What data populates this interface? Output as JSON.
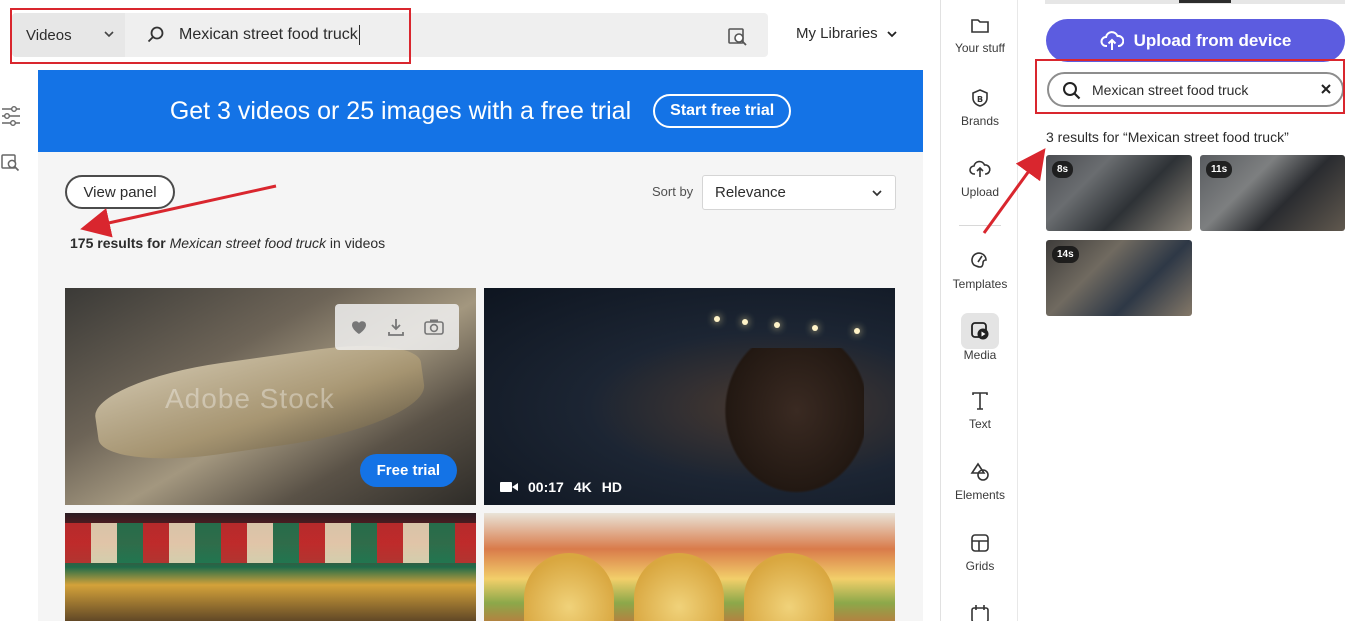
{
  "stock": {
    "search": {
      "type_label": "Videos",
      "query": "Mexican street food truck"
    },
    "my_libraries_label": "My Libraries",
    "promo": {
      "text": "Get 3 videos or 25 images with a free trial",
      "button": "Start free trial"
    },
    "view_panel_label": "View panel",
    "sort": {
      "label": "Sort by",
      "value": "Relevance"
    },
    "results": {
      "count": "175 results for",
      "query": "Mexican street food truck",
      "suffix": "in videos"
    },
    "tiles": [
      {
        "watermark": "Adobe Stock",
        "cta": "Free trial"
      },
      {
        "duration": "00:17",
        "quality1": "4K",
        "quality2": "HD"
      }
    ]
  },
  "sidenav": {
    "items": [
      {
        "label": "Your stuff",
        "icon": "folder-icon"
      },
      {
        "label": "Brands",
        "icon": "brand-icon"
      },
      {
        "label": "Upload",
        "icon": "upload-cloud-icon"
      },
      {
        "label": "Templates",
        "icon": "templates-icon"
      },
      {
        "label": "Media",
        "icon": "media-icon"
      },
      {
        "label": "Text",
        "icon": "text-icon"
      },
      {
        "label": "Elements",
        "icon": "elements-icon"
      },
      {
        "label": "Grids",
        "icon": "grids-icon"
      }
    ]
  },
  "panel": {
    "upload_label": "Upload from device",
    "search_query": "Mexican street food truck",
    "results_text": "3 results for “Mexican street food truck”",
    "thumbs": [
      {
        "duration": "8s"
      },
      {
        "duration": "11s"
      },
      {
        "duration": "14s"
      }
    ]
  },
  "colors": {
    "adobe_blue": "#1473e6",
    "express_purple": "#5c5ce0",
    "annotation_red": "#d9262e"
  }
}
